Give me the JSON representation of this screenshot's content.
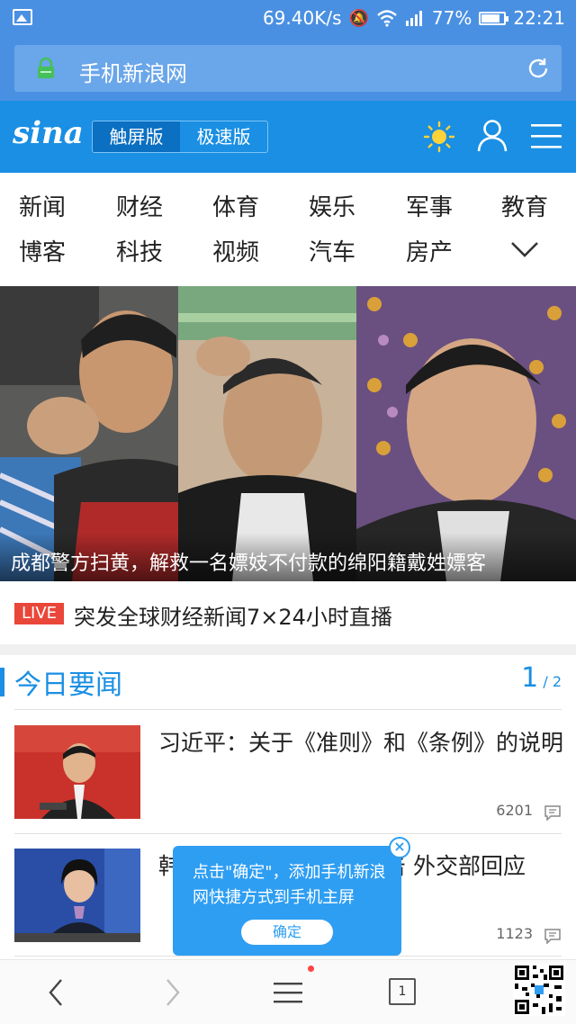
{
  "status_bar": {
    "speed": "69.40K/s",
    "battery": "77%",
    "time": "22:21"
  },
  "url_bar": {
    "text": "手机新浪网"
  },
  "header": {
    "logo": "sina",
    "version_touch": "触屏版",
    "version_fast": "极速版"
  },
  "categories": [
    "新闻",
    "财经",
    "体育",
    "娱乐",
    "军事",
    "教育",
    "博客",
    "科技",
    "视频",
    "汽车",
    "房产"
  ],
  "hero": {
    "caption": "成都警方扫黄，解救一名嫖妓不付款的绵阳籍戴姓嫖客"
  },
  "live": {
    "badge": "LIVE",
    "text": "突发全球财经新闻7×24小时直播"
  },
  "section": {
    "title": "今日要闻",
    "page_current": "1",
    "page_total": "/ 2"
  },
  "news": [
    {
      "headline": "习近平：关于《准则》和《条例》的说明",
      "count": "6201"
    },
    {
      "headline": "韩国海警向中国渔船射击 外交部回应",
      "count": "1123"
    }
  ],
  "popup": {
    "message": "点击\"确定\"，添加手机新浪网快捷方式到手机主屏",
    "ok": "确定",
    "close": "×"
  },
  "toolbar": {
    "tab_count": "1"
  },
  "colors": {
    "brand": "#1a8fe3",
    "statusbar": "#4a90e2",
    "live": "#e9473a"
  }
}
